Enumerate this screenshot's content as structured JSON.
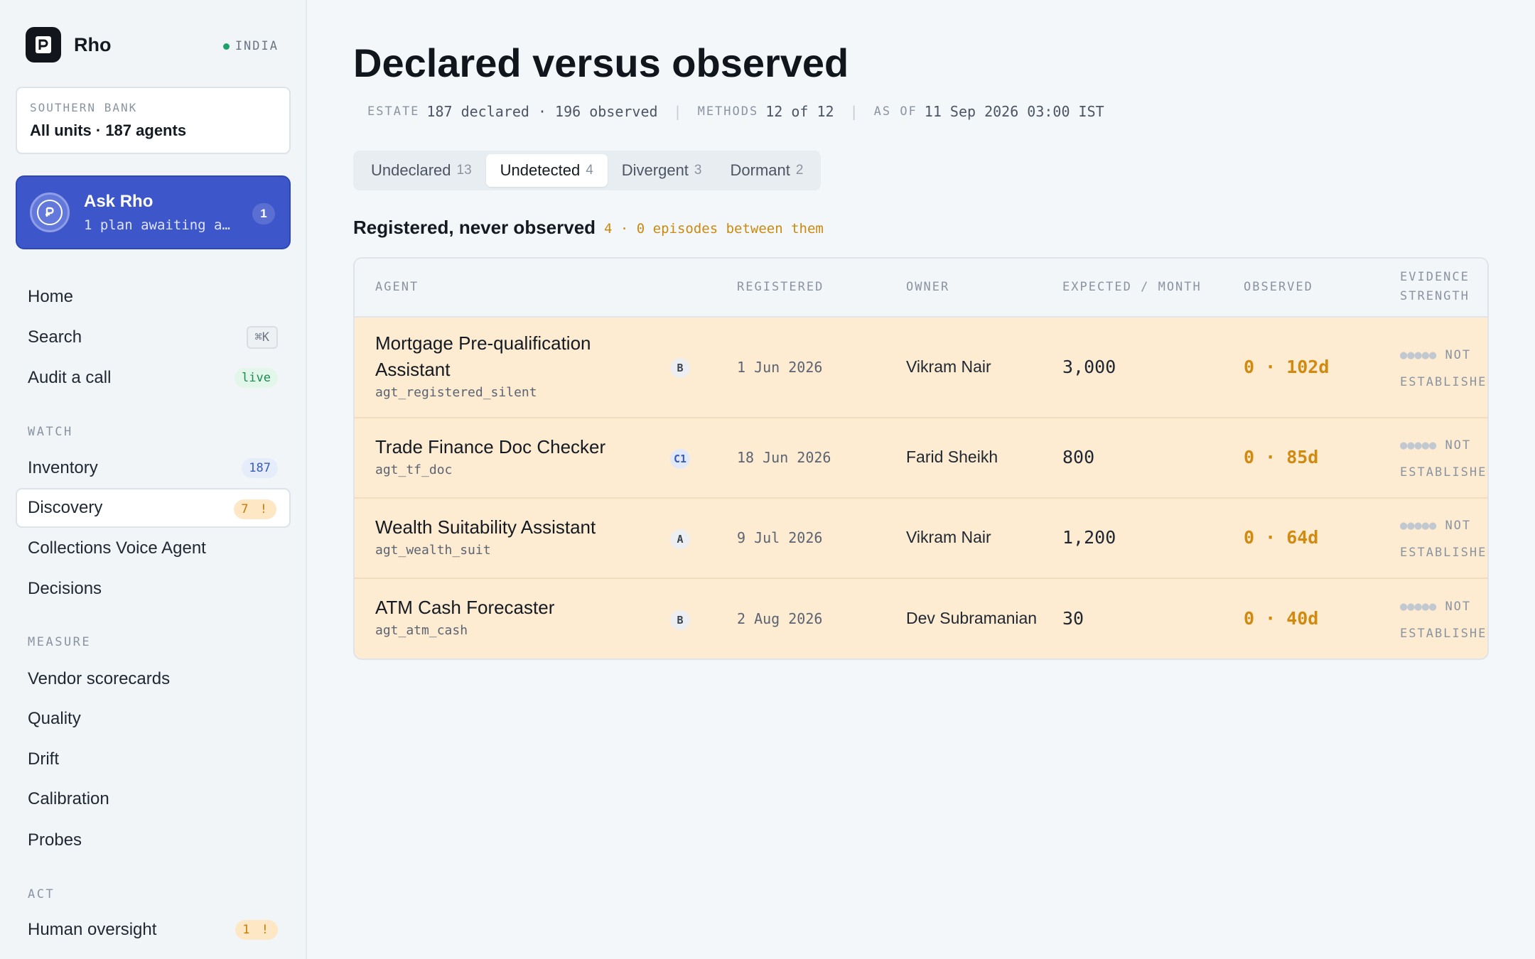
{
  "brand": {
    "name": "Rho",
    "region": "INDIA",
    "logo_letter": "P"
  },
  "org": {
    "label": "SOUTHERN BANK",
    "scope": "All units · 187 agents"
  },
  "ask": {
    "title": "Ask Rho",
    "subtitle": "1 plan awaiting a…",
    "badge": "1"
  },
  "nav": {
    "home": "Home",
    "search": "Search",
    "search_shortcut": "⌘K",
    "audit": "Audit a call",
    "audit_badge": "live",
    "watch_label": "WATCH",
    "inventory": "Inventory",
    "inventory_badge": "187",
    "discovery": "Discovery",
    "discovery_badge": "7 !",
    "collections": "Collections Voice Agent",
    "decisions": "Decisions",
    "measure_label": "MEASURE",
    "vendor": "Vendor scorecards",
    "quality": "Quality",
    "drift": "Drift",
    "calibration": "Calibration",
    "probes": "Probes",
    "act_label": "ACT",
    "oversight": "Human oversight",
    "oversight_badge": "1 !"
  },
  "page": {
    "title": "Declared versus observed",
    "meta": {
      "estate_key": "ESTATE",
      "estate_val": "187 declared · 196 observed",
      "methods_key": "METHODS",
      "methods_val": "12 of 12",
      "asof_key": "AS OF",
      "asof_val": "11 Sep 2026 03:00 IST"
    },
    "tabs": [
      {
        "label": "Undeclared",
        "count": "13"
      },
      {
        "label": "Undetected",
        "count": "4"
      },
      {
        "label": "Divergent",
        "count": "3"
      },
      {
        "label": "Dormant",
        "count": "2"
      }
    ],
    "active_tab": "Undetected",
    "section_title": "Registered, never observed",
    "section_note": "4 · 0 episodes between them"
  },
  "table": {
    "headers": {
      "agent": "AGENT",
      "registered": "REGISTERED",
      "owner": "OWNER",
      "expected": "EXPECTED / MONTH",
      "observed": "OBSERVED",
      "evidence_1": "EVIDENCE",
      "evidence_2": "STRENGTH"
    },
    "rows": [
      {
        "name": "Mortgage Pre-qualification Assistant",
        "id": "agt_registered_silent",
        "tier": "B",
        "registered": "1 Jun 2026",
        "owner": "Vikram Nair",
        "expected": "3,000",
        "observed": "0 · 102d",
        "evidence_dots": "●●●●●",
        "evidence_1": "NOT",
        "evidence_2": "ESTABLISHED"
      },
      {
        "name": "Trade Finance Doc Checker",
        "id": "agt_tf_doc",
        "tier": "C1",
        "registered": "18 Jun 2026",
        "owner": "Farid Sheikh",
        "expected": "800",
        "observed": "0 · 85d",
        "evidence_dots": "●●●●●",
        "evidence_1": "NOT",
        "evidence_2": "ESTABLISHED"
      },
      {
        "name": "Wealth Suitability Assistant",
        "id": "agt_wealth_suit",
        "tier": "A",
        "registered": "9 Jul 2026",
        "owner": "Vikram Nair",
        "expected": "1,200",
        "observed": "0 · 64d",
        "evidence_dots": "●●●●●",
        "evidence_1": "NOT",
        "evidence_2": "ESTABLISHED"
      },
      {
        "name": "ATM Cash Forecaster",
        "id": "agt_atm_cash",
        "tier": "B",
        "registered": "2 Aug 2026",
        "owner": "Dev Subramanian",
        "expected": "30",
        "observed": "0 · 40d",
        "evidence_dots": "●●●●●",
        "evidence_1": "NOT",
        "evidence_2": "ESTABLISHED"
      }
    ]
  }
}
